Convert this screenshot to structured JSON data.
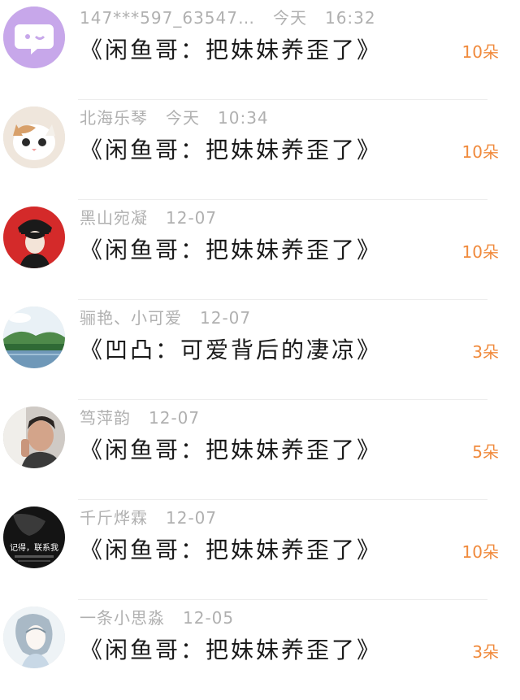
{
  "gift_list": [
    {
      "user": "147***597_63547…",
      "date": "今天",
      "time": "16:32",
      "title": "《闲鱼哥：把妹妹养歪了》",
      "amount": "10朵",
      "avatar_icon": "chat-bubble-avatar"
    },
    {
      "user": "北海乐琴",
      "date": "今天",
      "time": "10:34",
      "title": "《闲鱼哥：把妹妹养歪了》",
      "amount": "10朵",
      "avatar_icon": "cat-avatar"
    },
    {
      "user": "黑山宛凝",
      "date": "12-07",
      "time": "",
      "title": "《闲鱼哥：把妹妹养歪了》",
      "amount": "10朵",
      "avatar_icon": "anime-character-avatar"
    },
    {
      "user": "骊艳、小可爱",
      "date": "12-07",
      "time": "",
      "title": "《凹凸：可爱背后的凄凉》",
      "amount": "3朵",
      "avatar_icon": "landscape-avatar"
    },
    {
      "user": "笃萍韵",
      "date": "12-07",
      "time": "",
      "title": "《闲鱼哥：把妹妹养歪了》",
      "amount": "5朵",
      "avatar_icon": "person-photo-avatar"
    },
    {
      "user": "千斤烨霖",
      "date": "12-07",
      "time": "",
      "title": "《闲鱼哥：把妹妹养歪了》",
      "amount": "10朵",
      "avatar_icon": "dark-text-avatar"
    },
    {
      "user": "一条小思淼",
      "date": "12-05",
      "time": "",
      "title": "《闲鱼哥：把妹妹养歪了》",
      "amount": "3朵",
      "avatar_icon": "sketch-girl-avatar"
    }
  ],
  "avatar_overlay_text": "记得，联系我",
  "colors": {
    "amount": "#f08a3c",
    "meta": "#b0b0b0",
    "title": "#1a1a1a",
    "divider": "#ececec"
  }
}
